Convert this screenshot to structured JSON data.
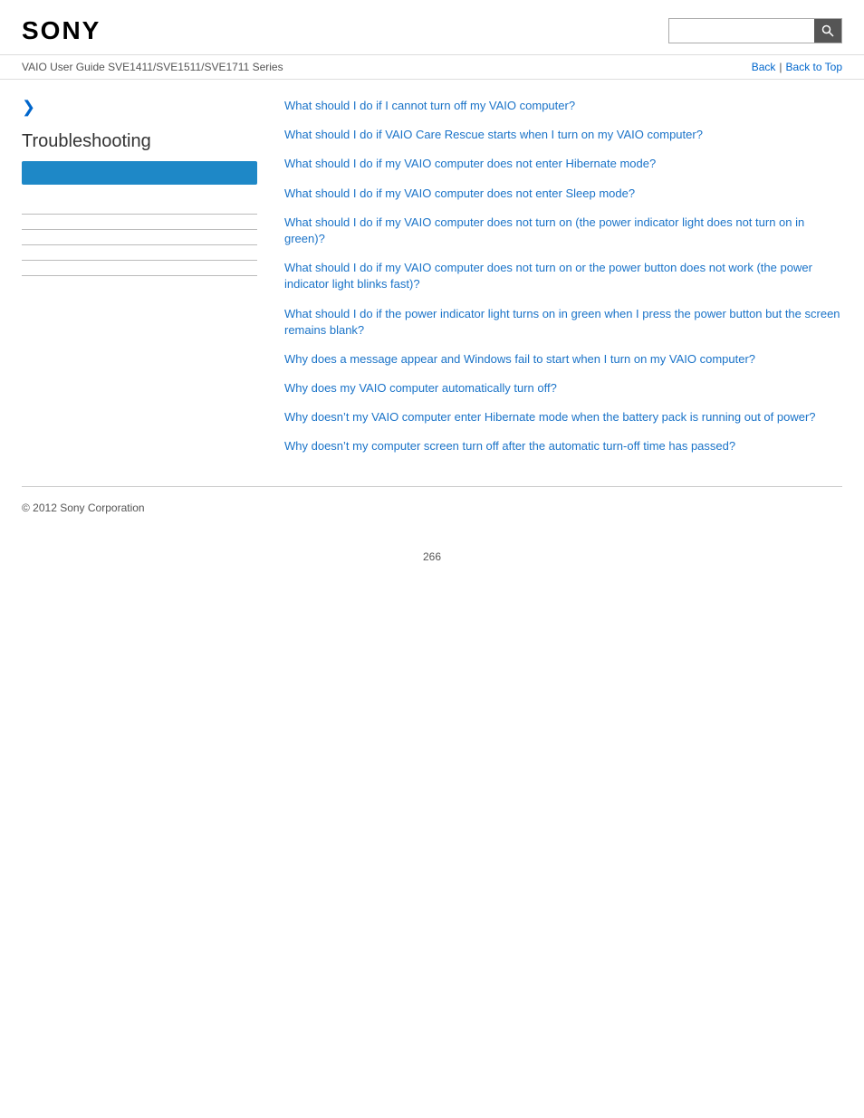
{
  "header": {
    "logo": "SONY",
    "search_placeholder": ""
  },
  "nav": {
    "title": "VAIO User Guide SVE1411/SVE1511/SVE1711 Series",
    "back_label": "Back",
    "back_to_top_label": "Back to Top"
  },
  "sidebar": {
    "expand_arrow": "❯",
    "section_title": "Troubleshooting",
    "links": [
      {
        "label": ""
      },
      {
        "label": ""
      },
      {
        "label": ""
      },
      {
        "label": ""
      },
      {
        "label": ""
      }
    ]
  },
  "content": {
    "links": [
      "What should I do if I cannot turn off my VAIO computer?",
      "What should I do if VAIO Care Rescue starts when I turn on my VAIO computer?",
      "What should I do if my VAIO computer does not enter Hibernate mode?",
      "What should I do if my VAIO computer does not enter Sleep mode?",
      "What should I do if my VAIO computer does not turn on (the power indicator light does not turn on in green)?",
      "What should I do if my VAIO computer does not turn on or the power button does not work (the power indicator light blinks fast)?",
      "What should I do if the power indicator light turns on in green when I press the power button but the screen remains blank?",
      "Why does a message appear and Windows fail to start when I turn on my VAIO computer?",
      "Why does my VAIO computer automatically turn off?",
      "Why doesn’t my VAIO computer enter Hibernate mode when the battery pack is running out of power?",
      "Why doesn’t my computer screen turn off after the automatic turn-off time has passed?"
    ]
  },
  "footer": {
    "copyright": "© 2012 Sony Corporation"
  },
  "page_number": "266",
  "icons": {
    "search": "🔍"
  }
}
